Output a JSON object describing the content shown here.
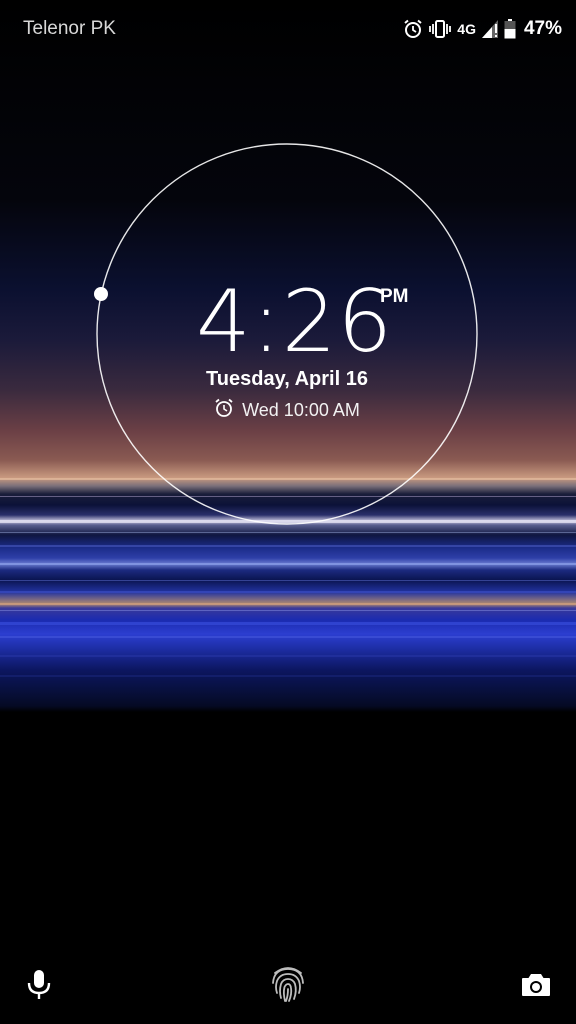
{
  "status_bar": {
    "carrier": "Telenor PK",
    "network_type": "4G",
    "battery_percent": "47%",
    "icons": [
      "alarm-icon",
      "vibrate-icon",
      "signal-icon",
      "battery-icon"
    ]
  },
  "lockscreen": {
    "time": "4:26",
    "ampm": "PM",
    "date": "Tuesday, April 16",
    "next_alarm": "Wed 10:00 AM"
  },
  "bottom_shortcuts": {
    "left": "microphone-icon",
    "center": "fingerprint-icon",
    "right": "camera-icon"
  },
  "colors": {
    "text": "#ffffff",
    "carrier_text": "#d8d8d8",
    "ring": "#ffffff",
    "background": "#000000"
  }
}
